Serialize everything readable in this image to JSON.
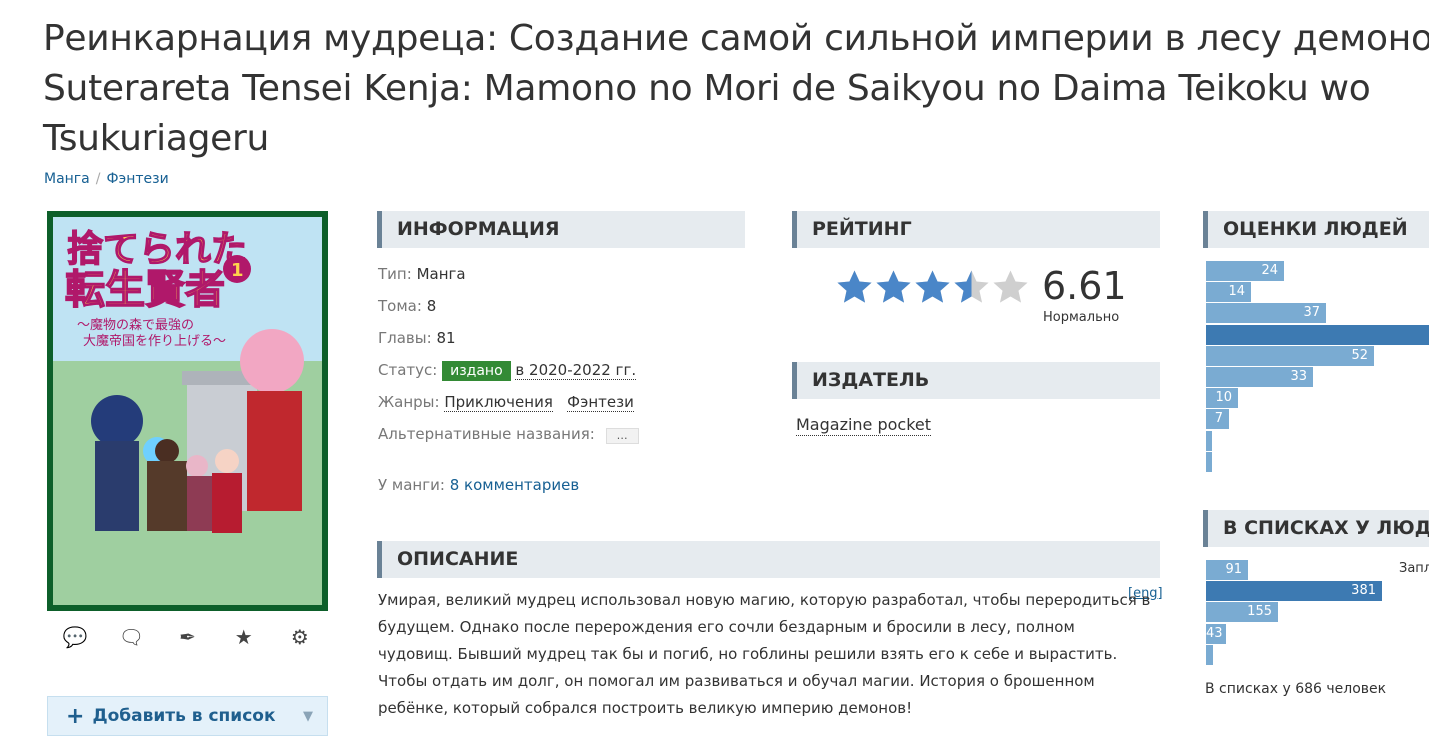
{
  "title": {
    "line1": "Реинкарнация мудреца: Создание самой сильной империи в лесу демонов",
    "line2": "Suterareta Tensei Kenja: Mamono no Mori de Saikyou no Daima Teikoku wo",
    "line3": "Tsukuriageru"
  },
  "breadcrumb": {
    "item1": "Манга",
    "separator": "/",
    "item2": "Фэнтези"
  },
  "cover": {
    "title_jp": "捨てられた転生賢者",
    "subtitle_jp": "～魔物の森で最強の大魔帝国を作り上げる～",
    "volume": "1",
    "colors": {
      "background": "#0d5f2a",
      "title_fill": "#ffd34d",
      "title_stroke": "#b0186a",
      "sky": "#bfe3f3"
    }
  },
  "action_icons": [
    "comments-icon",
    "chat-icon",
    "quill-icon",
    "star-icon",
    "gears-icon"
  ],
  "add_button": {
    "label": "Добавить в список",
    "plus": "+",
    "arrow": "▼"
  },
  "info": {
    "header": "Информация",
    "type_label": "Тип:",
    "type_value": "Манга",
    "volumes_label": "Тома:",
    "volumes_value": "8",
    "chapters_label": "Главы:",
    "chapters_value": "81",
    "status_label": "Статус:",
    "status_badge": "издано",
    "status_years": "в 2020-2022 гг.",
    "status_color": "#338a35",
    "genres_label": "Жанры:",
    "genre1": "Приключения",
    "genre2": "Фэнтези",
    "alt_names_label": "Альтернативные названия:",
    "alt_names_button": "…",
    "comments_label": "У манги:",
    "comments_link": "8 комментариев"
  },
  "description": {
    "header": "Описание",
    "eng_link": "[eng]",
    "text": "Умирая, великий мудрец использовал новую магию, которую разработал, чтобы переродиться в будущем. Однако после перерождения его сочли бездарным и бросили в лесу, полном чудовищ. Бывший мудрец так бы и погиб, но гоблины решили взять его к себе и вырастить. Чтобы отдать им долг, он помогал им развиваться и обучал магии. История о брошенном ребёнке, который собрался построить великую империю демонов!"
  },
  "rating": {
    "header": "Рейтинг",
    "score": "6.61",
    "score_value": 6.61,
    "stars_filled": 3.5,
    "stars_total": 5,
    "label": "Нормально",
    "star_color": "#4a86c8",
    "star_empty_color": "#cfcfcf"
  },
  "publisher": {
    "header": "Издатель",
    "name": "Magazine pocket"
  },
  "people_ratings": {
    "header": "Оценки людей",
    "bar_color": "#7aabd2",
    "bar_dark_color": "#3d7ab2",
    "bars": [
      {
        "value": 24,
        "label": "24"
      },
      {
        "value": 14,
        "label": "14"
      },
      {
        "value": 37,
        "label": "37"
      },
      {
        "value": 75,
        "label": ""
      },
      {
        "value": 52,
        "label": "52"
      },
      {
        "value": 33,
        "label": "33"
      },
      {
        "value": 10,
        "label": "10"
      },
      {
        "value": 7,
        "label": "7"
      },
      {
        "value": 1,
        "label": ""
      },
      {
        "value": 1,
        "label": ""
      }
    ]
  },
  "people_lists": {
    "header": "В списках у людей",
    "first_status": "Запл",
    "bars": [
      {
        "value": 91,
        "label": "91"
      },
      {
        "value": 381,
        "label": "381"
      },
      {
        "value": 155,
        "label": "155"
      },
      {
        "value": 43,
        "label": "43"
      },
      {
        "value": 16,
        "label": ""
      }
    ],
    "summary": "В списках у 686 человек"
  }
}
